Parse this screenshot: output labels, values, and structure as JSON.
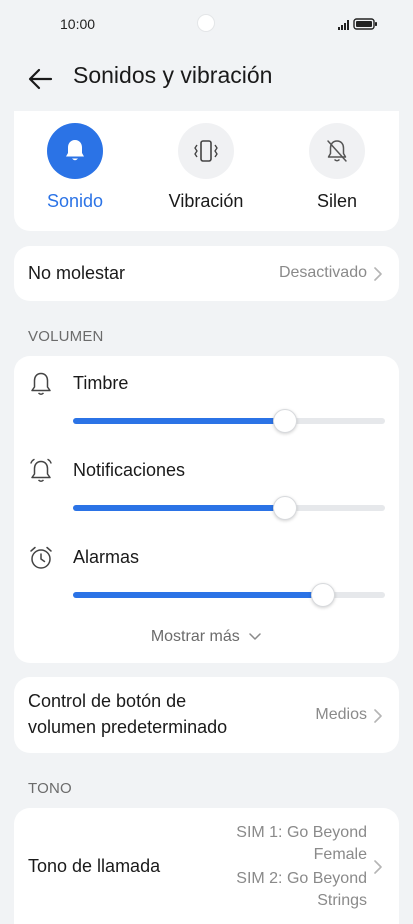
{
  "status": {
    "time": "10:00"
  },
  "header": {
    "title": "Sonidos y vibración"
  },
  "modes": [
    {
      "label": "Sonido",
      "icon": "bell-icon",
      "active": true
    },
    {
      "label": "Vibración",
      "icon": "vibrate-icon",
      "active": false
    },
    {
      "label": "Silen",
      "icon": "bell-off-icon",
      "active": false
    }
  ],
  "do_not_disturb": {
    "label": "No molestar",
    "value": "Desactivado"
  },
  "volume": {
    "section_label": "VOLUMEN",
    "items": [
      {
        "label": "Timbre",
        "icon": "bell-outline-icon",
        "level": 0.68
      },
      {
        "label": "Notificaciones",
        "icon": "notification-bell-icon",
        "level": 0.68
      },
      {
        "label": "Alarmas",
        "icon": "alarm-clock-icon",
        "level": 0.8
      }
    ],
    "show_more": "Mostrar más"
  },
  "volume_button": {
    "label_line1": "Control de botón de",
    "label_line2": "volumen predeterminado",
    "value": "Medios"
  },
  "tone": {
    "section_label": "TONO",
    "ringtone_label": "Tono de llamada",
    "sim1_line1": "SIM 1: Go Beyond",
    "sim1_line2": "Female",
    "sim2_line1": "SIM 2: Go Beyond",
    "sim2_line2": "Strings"
  },
  "colors": {
    "accent": "#2b73e6",
    "background": "#f1f3f5",
    "card": "#ffffff",
    "secondary_text": "#8a8a8a"
  }
}
